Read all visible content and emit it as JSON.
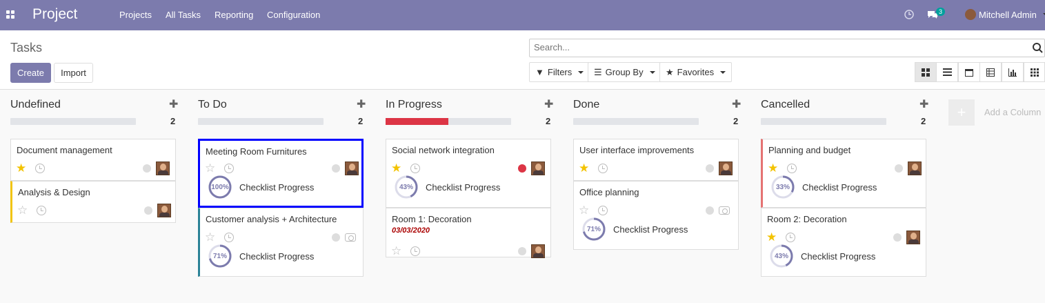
{
  "app": {
    "brand": "Project",
    "menu": [
      "Projects",
      "All Tasks",
      "Reporting",
      "Configuration"
    ],
    "user": "Mitchell Admin",
    "messages_count": "3"
  },
  "control": {
    "title": "Tasks",
    "create": "Create",
    "import": "Import",
    "search_placeholder": "Search...",
    "filters": "Filters",
    "group_by": "Group By",
    "favorites": "Favorites"
  },
  "columns": [
    {
      "name": "Undefined",
      "count": "2",
      "progress": 0,
      "cards": [
        {
          "title": "Document management",
          "starred": true,
          "border": "",
          "avatar": true
        },
        {
          "title": "Analysis & Design",
          "starred": false,
          "border": "#f1c40f",
          "avatar": true
        }
      ]
    },
    {
      "name": "To Do",
      "count": "2",
      "progress": 0,
      "cards": [
        {
          "title": "Meeting Room Furnitures",
          "starred": false,
          "border": "",
          "avatar": true,
          "selected": true,
          "progress": "100%",
          "label": "Checklist Progress"
        },
        {
          "title": "Customer analysis + Architecture",
          "starred": false,
          "border": "#2c8397",
          "avatar": false,
          "progress": "71%",
          "label": "Checklist Progress"
        }
      ]
    },
    {
      "name": "In Progress",
      "count": "2",
      "progress": 0.5,
      "cards": [
        {
          "title": "Social network integration",
          "starred": true,
          "border": "",
          "avatar": true,
          "dot": "red",
          "progress": "43%",
          "label": "Checklist Progress"
        },
        {
          "title": "Room 1: Decoration",
          "starred": false,
          "border": "",
          "avatar": true,
          "date": "03/03/2020"
        }
      ]
    },
    {
      "name": "Done",
      "count": "2",
      "progress": 0,
      "cards": [
        {
          "title": "User interface improvements",
          "starred": true,
          "border": "",
          "avatar": true
        },
        {
          "title": "Office planning",
          "starred": false,
          "border": "",
          "avatar": false,
          "progress": "71%",
          "label": "Checklist Progress"
        }
      ]
    },
    {
      "name": "Cancelled",
      "count": "2",
      "progress": 0,
      "cards": [
        {
          "title": "Planning and budget",
          "starred": true,
          "border": "#e57373",
          "avatar": true,
          "progress": "33%",
          "label": "Checklist Progress"
        },
        {
          "title": "Room 2: Decoration",
          "starred": true,
          "border": "",
          "avatar": true,
          "progress": "43%",
          "label": "Checklist Progress"
        }
      ]
    }
  ],
  "add_column": "Add a Column",
  "colors": {
    "brand": "#7c7bad",
    "star": "#f3c300",
    "selected": "#0000ff"
  }
}
